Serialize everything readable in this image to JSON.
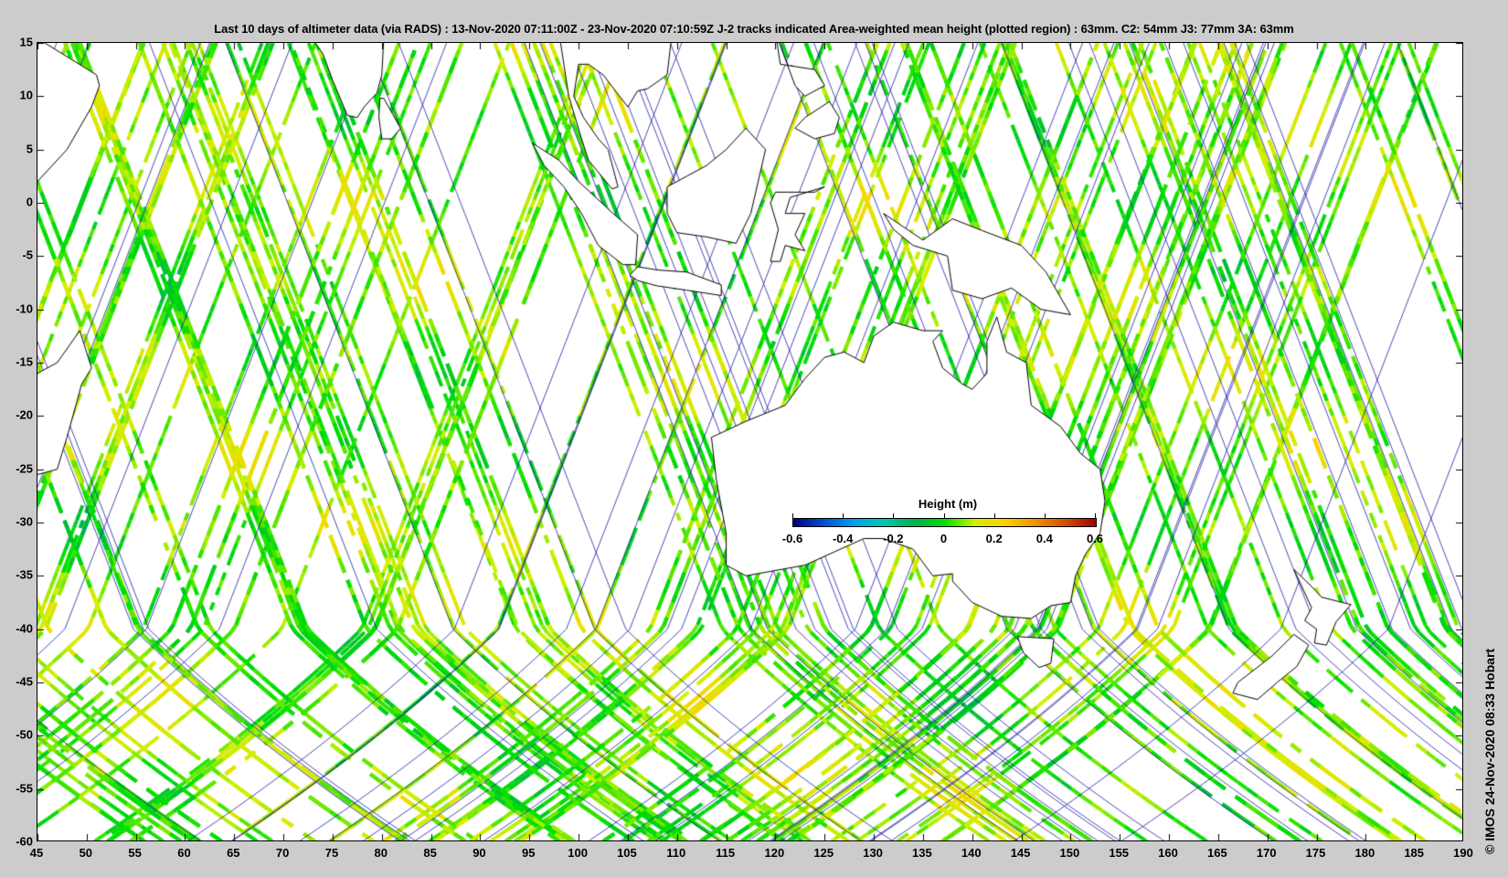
{
  "title": "Last 10 days of altimeter data (via RADS) : 13-Nov-2020 07:11:00Z - 23-Nov-2020 07:10:59Z  J-2 tracks indicated  Area-weighted mean height (plotted region) : 63mm.  C2: 54mm  J3: 77mm  3A: 63mm",
  "side_label": "© IMOS 24-Nov-2020 08:33 Hobart",
  "map": {
    "lon_range": [
      45,
      190
    ],
    "lat_range": [
      -60,
      15
    ],
    "x_ticks": [
      "45",
      "50",
      "55",
      "60",
      "65",
      "70",
      "75",
      "80",
      "85",
      "90",
      "95",
      "100",
      "105",
      "110",
      "115",
      "120",
      "125",
      "130",
      "135",
      "140",
      "145",
      "150",
      "155",
      "160",
      "165",
      "170",
      "175",
      "180",
      "185",
      "190"
    ],
    "y_ticks": [
      "15",
      "10",
      "5",
      "0",
      "-5",
      "-10",
      "-15",
      "-20",
      "-25",
      "-30",
      "-35",
      "-40",
      "-45",
      "-50",
      "-55",
      "-60"
    ],
    "colors": {
      "track_line": "#1a1aa0",
      "land": "#ffffff",
      "coast": "#000000",
      "background": "#cccccc"
    }
  },
  "colorbar": {
    "title": "Height (m)",
    "range": [
      -0.6,
      0.6
    ],
    "tick_labels": [
      "-0.6",
      "-0.4",
      "-0.2",
      "0",
      "0.2",
      "0.4",
      "0.6"
    ],
    "colormap": [
      "#000080",
      "#0050d0",
      "#00a0f0",
      "#00c8b0",
      "#00b050",
      "#00e000",
      "#d0f000",
      "#ffd000",
      "#f09000",
      "#d05000",
      "#a00000"
    ]
  }
}
